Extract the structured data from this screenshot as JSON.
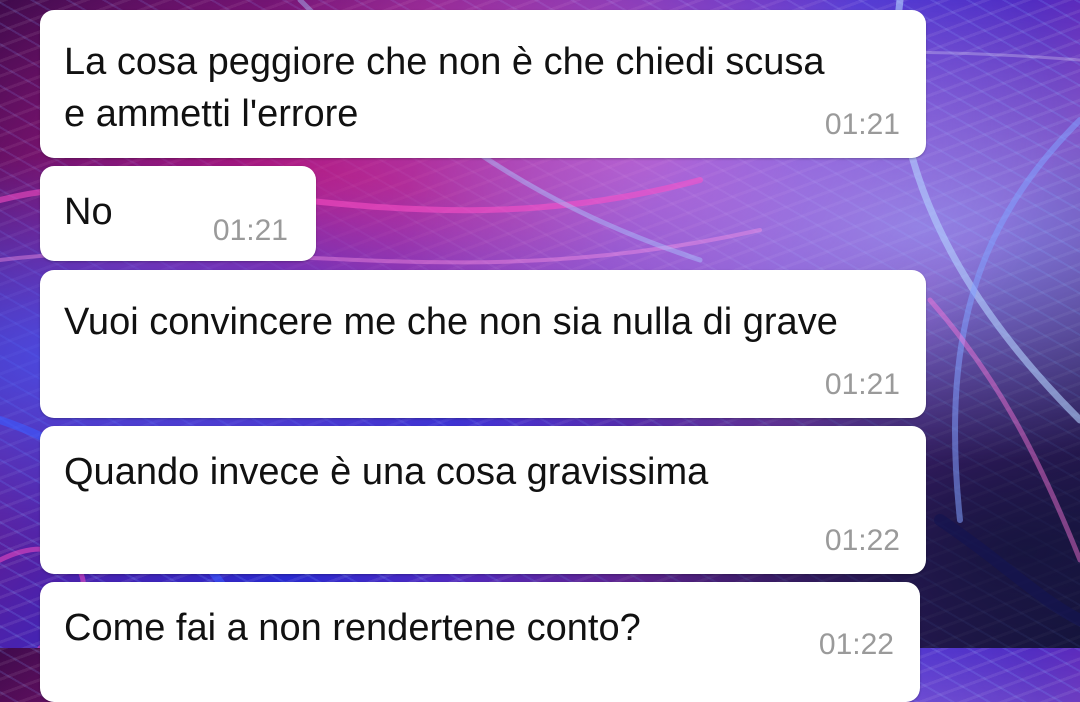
{
  "messages": [
    {
      "text": "La cosa peggiore che non è che chiedi scusa e ammetti l'errore",
      "time": "01:21"
    },
    {
      "text": "No",
      "time": "01:21"
    },
    {
      "text": "Vuoi convincere me che non sia nulla di grave",
      "time": "01:21"
    },
    {
      "text": "Quando invece è una cosa gravissima",
      "time": "01:22"
    },
    {
      "text": "Come fai a non rendertene conto?",
      "time": "01:22"
    }
  ],
  "colors": {
    "bubble_background": "#ffffff",
    "message_text": "#111111",
    "timestamp": "#9a9a9a"
  }
}
